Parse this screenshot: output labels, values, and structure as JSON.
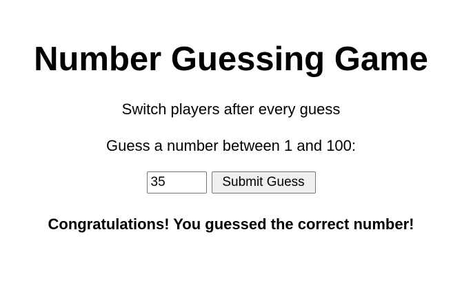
{
  "game": {
    "title": "Number Guessing Game",
    "subtitle": "Switch players after every guess",
    "prompt": "Guess a number between 1 and 100:",
    "guess_value": "35",
    "submit_label": "Submit Guess",
    "result_message": "Congratulations! You guessed the correct number!"
  }
}
